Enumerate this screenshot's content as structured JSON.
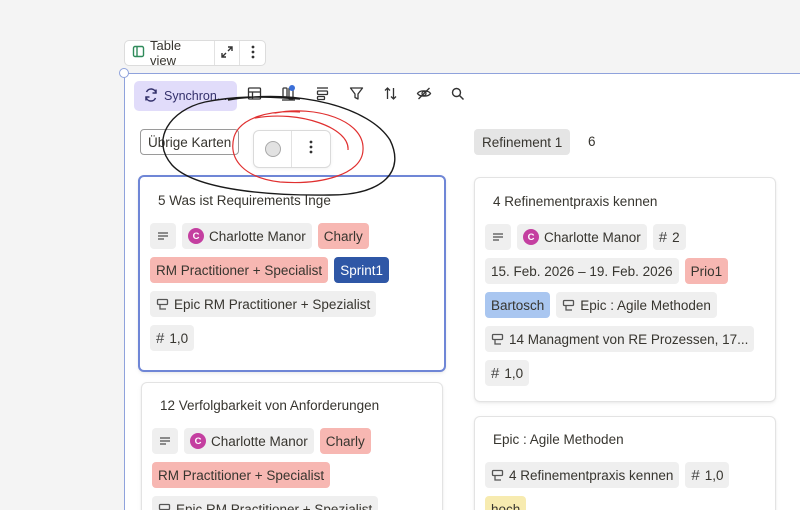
{
  "view": {
    "label": "Table view"
  },
  "toolbar": {
    "sync_label": "Synchron..."
  },
  "columns": [
    {
      "label": "Übrige Karten"
    },
    {
      "label": "Refinement 1",
      "count": "6"
    }
  ],
  "cards": [
    {
      "title": "5 Was ist Requirements Inge",
      "person": "Charlotte Manor",
      "person_initial": "C",
      "tag1": "Charly",
      "tag2": "RM Practitioner + Specialist",
      "tag3": "Sprint1",
      "epic": "Epic RM Practitioner + Spezialist",
      "number": "1,0"
    },
    {
      "title": "12 Verfolgbarkeit von Anforderungen",
      "person": "Charlotte Manor",
      "person_initial": "C",
      "tag1": "Charly",
      "tag2": "RM Practitioner + Specialist",
      "epic": "Epic RM Practitioner + Spezialist"
    },
    {
      "title": "4 Refinementpraxis kennen",
      "person": "Charlotte Manor",
      "person_initial": "C",
      "count": "2",
      "dates": "15. Feb. 2026 – 19. Feb. 2026",
      "prio": "Prio1",
      "owner": "Bartosch",
      "epic": "Epic : Agile Methoden",
      "link": "14 Managment von RE Prozessen, 17...",
      "number": "1,0"
    },
    {
      "title": "Epic : Agile Methoden",
      "link": "4 Refinementpraxis kennen",
      "number": "1,0",
      "tag": "hoch"
    }
  ],
  "colors": {
    "sync_bg": "#e1dcfa",
    "frame_border": "#8fa2dc",
    "tag_red": "#f7b7b2",
    "tag_blue_dark": "#2f57a6",
    "tag_blue_light": "#a9c6f0",
    "tag_yellow": "#f7ebb0",
    "avatar": "#c43fa0",
    "annotation_black": "#1a1a1a",
    "annotation_red": "#e03030"
  }
}
